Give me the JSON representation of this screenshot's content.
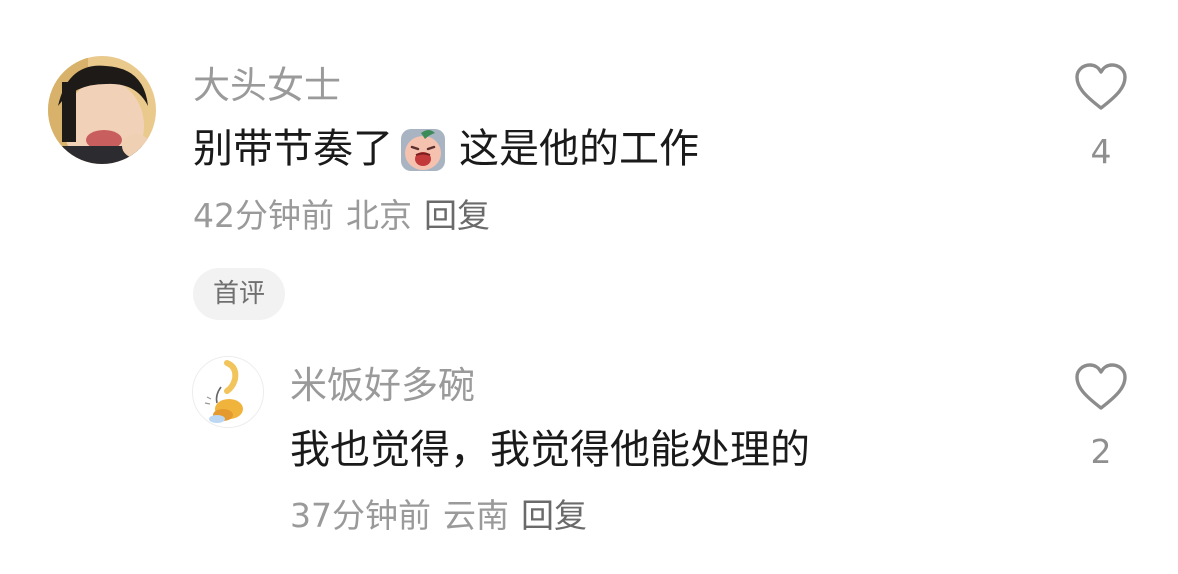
{
  "comments": [
    {
      "username": "大头女士",
      "text_before_emoji": "别带节奏了",
      "text_after_emoji": "这是他的工作",
      "emoji_name": "crying-face-sticker",
      "time": "42分钟前",
      "location": "北京",
      "reply_label": "回复",
      "badge": "首评",
      "likes": "4"
    },
    {
      "username": "米饭好多碗",
      "text": "我也觉得，我觉得他能处理的",
      "time": "37分钟前",
      "location": "云南",
      "reply_label": "回复",
      "likes": "2"
    }
  ],
  "colors": {
    "username": "#9a9a9a",
    "content": "#1a1a1a",
    "meta": "#9a9a9a",
    "badge_bg": "#f2f2f2"
  },
  "icons": [
    "heart-outline-icon"
  ]
}
